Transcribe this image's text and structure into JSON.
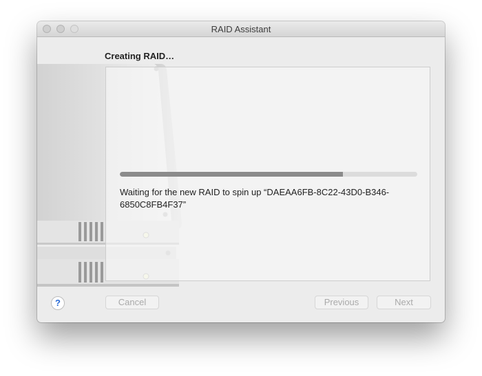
{
  "window": {
    "title": "RAID Assistant"
  },
  "header": {
    "title": "Creating RAID…"
  },
  "progress": {
    "fraction": 0.75,
    "status_text": "Waiting for the new RAID to spin up “DAEAA6FB-8C22-43D0-B346-6850C8FB4F37”"
  },
  "buttons": {
    "help_label": "?",
    "cancel_label": "Cancel",
    "previous_label": "Previous",
    "next_label": "Next"
  },
  "colors": {
    "progress_fill": "#8b8b8b",
    "progress_track": "#dcdcdc",
    "help_glyph": "#2a6bd6"
  }
}
